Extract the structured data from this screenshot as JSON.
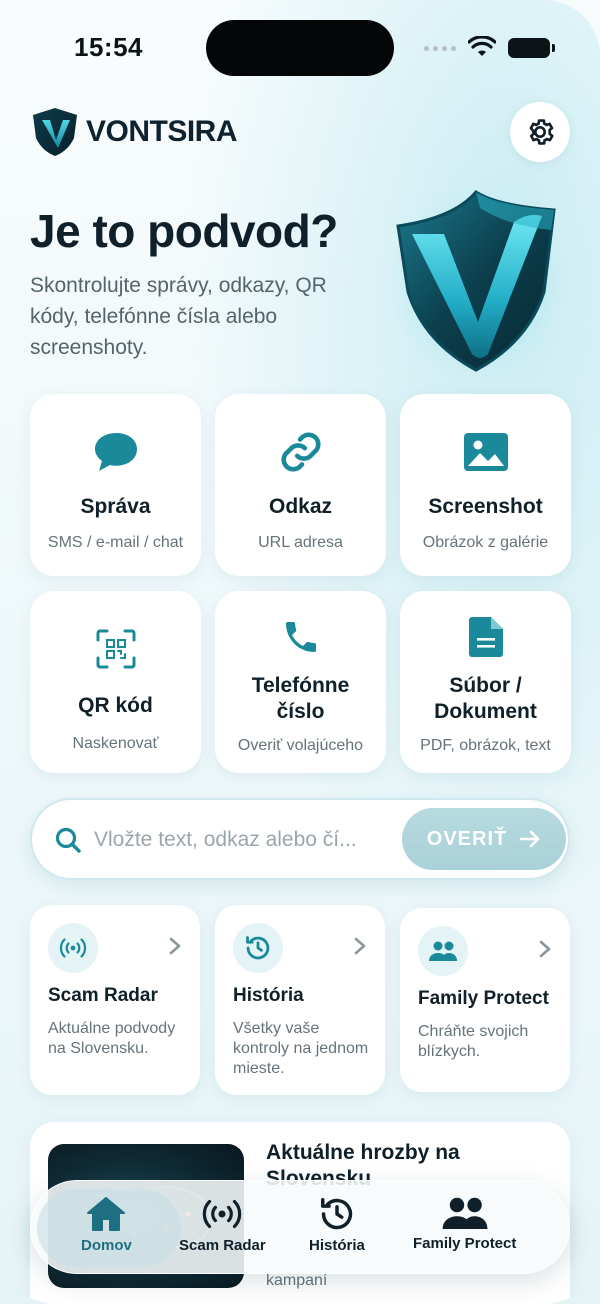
{
  "status_bar": {
    "time": "15:54"
  },
  "header": {
    "brand": "VONTSIRA"
  },
  "hero": {
    "title": "Je to podvod?",
    "subtitle": "Skontrolujte správy, odkazy, QR kódy, telefónne čísla alebo screenshoty."
  },
  "tiles": [
    {
      "title": "Správa",
      "subtitle": "SMS / e-mail / chat",
      "icon": "chat-bubble-icon"
    },
    {
      "title": "Odkaz",
      "subtitle": "URL adresa",
      "icon": "link-icon"
    },
    {
      "title": "Screenshot",
      "subtitle": "Obrázok z galérie",
      "icon": "image-icon"
    },
    {
      "title": "QR kód",
      "subtitle": "Naskenovať",
      "icon": "qr-scan-icon"
    },
    {
      "title": "Telefónne číslo",
      "subtitle": "Overiť volajúceho",
      "icon": "phone-icon"
    },
    {
      "title": "Súbor / Dokument",
      "subtitle": "PDF, obrázok, text",
      "icon": "document-icon"
    }
  ],
  "search": {
    "placeholder": "Vložte text, odkaz alebo čí...",
    "button_label": "OVERIŤ"
  },
  "features": [
    {
      "title": "Scam Radar",
      "subtitle": "Aktuálne podvody na Slovensku.",
      "icon": "radar-icon"
    },
    {
      "title": "História",
      "subtitle": "Všetky vaše kontroly na jednom mieste.",
      "icon": "history-icon"
    },
    {
      "title": "Family Protect",
      "subtitle": "Chráňte svojich blízkych.",
      "icon": "family-icon"
    }
  ],
  "threats": {
    "title": "Aktuálne hrozby na Slovensku",
    "footer": "kampaní"
  },
  "bottom_nav": [
    {
      "label": "Domov",
      "icon": "home-icon",
      "active": true
    },
    {
      "label": "Scam Radar",
      "icon": "radar-icon"
    },
    {
      "label": "História",
      "icon": "history-icon"
    },
    {
      "label": "Family Protect",
      "icon": "family-icon"
    }
  ],
  "colors": {
    "accent": "#1a8a9a",
    "accent_dark": "#1f6f83",
    "text": "#10202a",
    "muted": "#66737a"
  }
}
